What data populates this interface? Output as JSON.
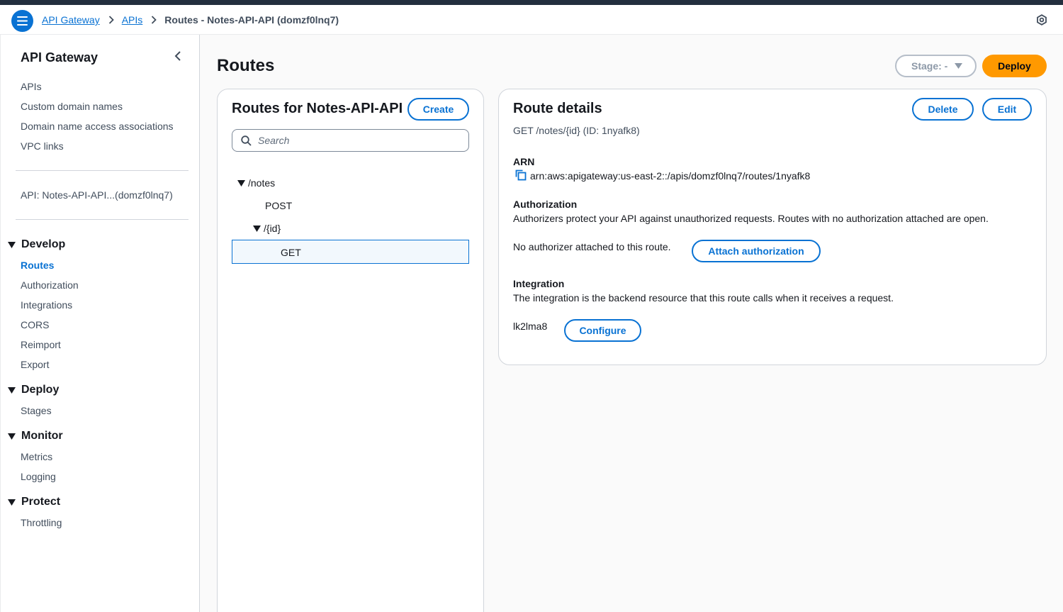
{
  "breadcrumb": {
    "items": [
      "API Gateway",
      "APIs"
    ],
    "current": "Routes - Notes-API-API (domzf0lnq7)"
  },
  "icons": {
    "menu": "hamburger-menu-icon",
    "settings": "settings-hexagon-icon",
    "search": "search-icon",
    "copy": "copy-icon",
    "collapse": "chevron-left-icon"
  },
  "colors": {
    "accent": "#0972d3",
    "deploy": "#ff9900",
    "topbar": "#232f3e",
    "selected_bg": "#f2f8fd"
  },
  "sidebar": {
    "title": "API Gateway",
    "top_links": [
      "APIs",
      "Custom domain names",
      "Domain name access associations",
      "VPC links"
    ],
    "api_link": "API: Notes-API-API...(domzf0lnq7)",
    "sections": [
      {
        "title": "Develop",
        "items": [
          "Routes",
          "Authorization",
          "Integrations",
          "CORS",
          "Reimport",
          "Export"
        ]
      },
      {
        "title": "Deploy",
        "items": [
          "Stages"
        ]
      },
      {
        "title": "Monitor",
        "items": [
          "Metrics",
          "Logging"
        ]
      },
      {
        "title": "Protect",
        "items": [
          "Throttling"
        ]
      }
    ],
    "active_item": "Routes"
  },
  "page": {
    "title": "Routes",
    "stage_label": "Stage: -",
    "deploy_label": "Deploy"
  },
  "routes_panel": {
    "title": "Routes for Notes-API-API",
    "create_label": "Create",
    "search_placeholder": "Search",
    "tree": {
      "root": "/notes",
      "root_method": "POST",
      "child": "/{id}",
      "child_method": "GET"
    }
  },
  "details": {
    "title": "Route details",
    "delete_label": "Delete",
    "edit_label": "Edit",
    "route_summary": "GET /notes/{id} (ID: 1nyafk8)",
    "arn_label": "ARN",
    "arn_value": "arn:aws:apigateway:us-east-2::/apis/domzf0lnq7/routes/1nyafk8",
    "authorization": {
      "label": "Authorization",
      "description": "Authorizers protect your API against unauthorized requests. Routes with no authorization attached are open.",
      "status": "No authorizer attached to this route.",
      "button": "Attach authorization"
    },
    "integration": {
      "label": "Integration",
      "description": "The integration is the backend resource that this route calls when it receives a request.",
      "id": "lk2lma8",
      "button": "Configure"
    }
  }
}
